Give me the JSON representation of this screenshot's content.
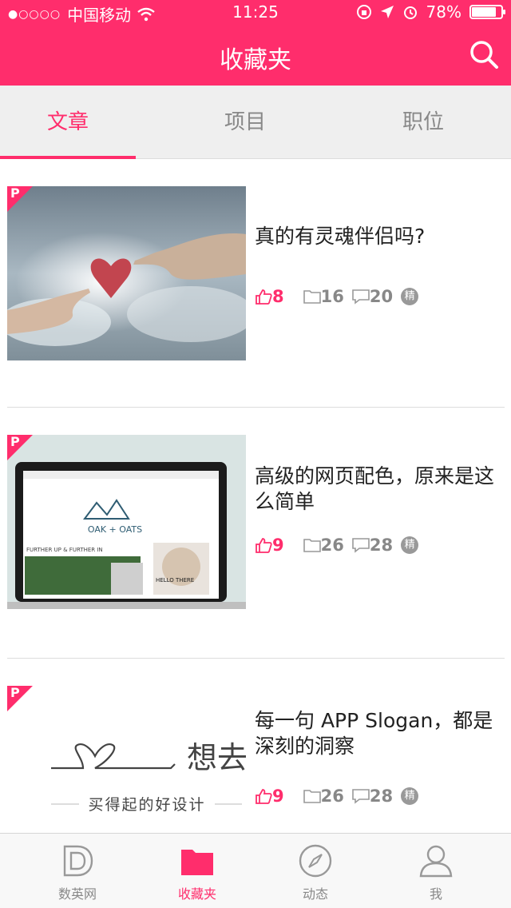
{
  "status_bar": {
    "signal": "●○○○○",
    "carrier": "中国移动",
    "time": "11:25",
    "battery_text": "78%",
    "battery_level": 0.78
  },
  "header": {
    "title": "收藏夹"
  },
  "tabs": [
    {
      "label": "文章",
      "active": true
    },
    {
      "label": "项目",
      "active": false
    },
    {
      "label": "职位",
      "active": false
    }
  ],
  "articles": [
    {
      "badge": "P",
      "title": "真的有灵魂伴侣吗?",
      "likes": "8",
      "favorites": "16",
      "comments": "20",
      "featured": "精"
    },
    {
      "badge": "P",
      "title": "高级的网页配色，原来是这么简单",
      "likes": "9",
      "favorites": "26",
      "comments": "28",
      "featured": "精",
      "thumb_text": {
        "brand": "OAK + OATS",
        "headline": "FURTHER UP & FURTHER IN",
        "hello": "HELLO THERE"
      }
    },
    {
      "badge": "P",
      "title": "每一句 APP Slogan，都是深刻的洞察",
      "likes": "9",
      "favorites": "26",
      "comments": "28",
      "featured": "精",
      "thumb_text": {
        "word": "想去",
        "slogan": "买得起的好设计"
      }
    }
  ],
  "tab_bar": [
    {
      "label": "数英网",
      "icon": "d-logo-icon",
      "active": false
    },
    {
      "label": "收藏夹",
      "icon": "folder-icon",
      "active": true
    },
    {
      "label": "动态",
      "icon": "compass-icon",
      "active": false
    },
    {
      "label": "我",
      "icon": "person-icon",
      "active": false
    }
  ],
  "colors": {
    "accent": "#ff2d6c",
    "muted": "#888888",
    "tab_bg": "#efefef"
  }
}
